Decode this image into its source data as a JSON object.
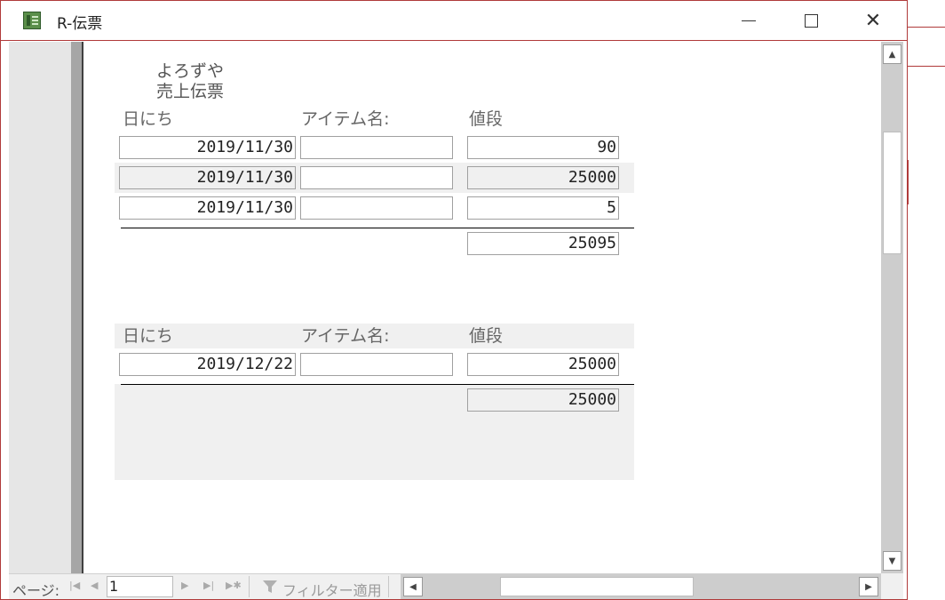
{
  "window": {
    "title": "R-伝票",
    "minimize_glyph": "",
    "maximize_glyph": "",
    "close_glyph": "✕"
  },
  "report": {
    "header_line1": "よろずや",
    "header_line2": "売上伝票",
    "groups": [
      {
        "labels": {
          "date": "日にち",
          "item": "アイテム名:",
          "price": "値段"
        },
        "rows": [
          {
            "date": "2019/11/30",
            "item": "",
            "price": "90"
          },
          {
            "date": "2019/11/30",
            "item": "",
            "price": "25000"
          },
          {
            "date": "2019/11/30",
            "item": "",
            "price": "5"
          }
        ],
        "total": "25095"
      },
      {
        "labels": {
          "date": "日にち",
          "item": "アイテム名:",
          "price": "値段"
        },
        "rows": [
          {
            "date": "2019/12/22",
            "item": "",
            "price": "25000"
          }
        ],
        "total": "25000"
      }
    ]
  },
  "navbar": {
    "page_label": "ページ:",
    "page_value": "1",
    "filter_label": "フィルター適用"
  },
  "icons": {
    "app": "access-report-icon",
    "first": "first-page-icon",
    "prev": "prev-page-icon",
    "next": "next-page-icon",
    "last": "last-page-icon",
    "new": "new-record-icon",
    "filter": "filter-icon"
  }
}
